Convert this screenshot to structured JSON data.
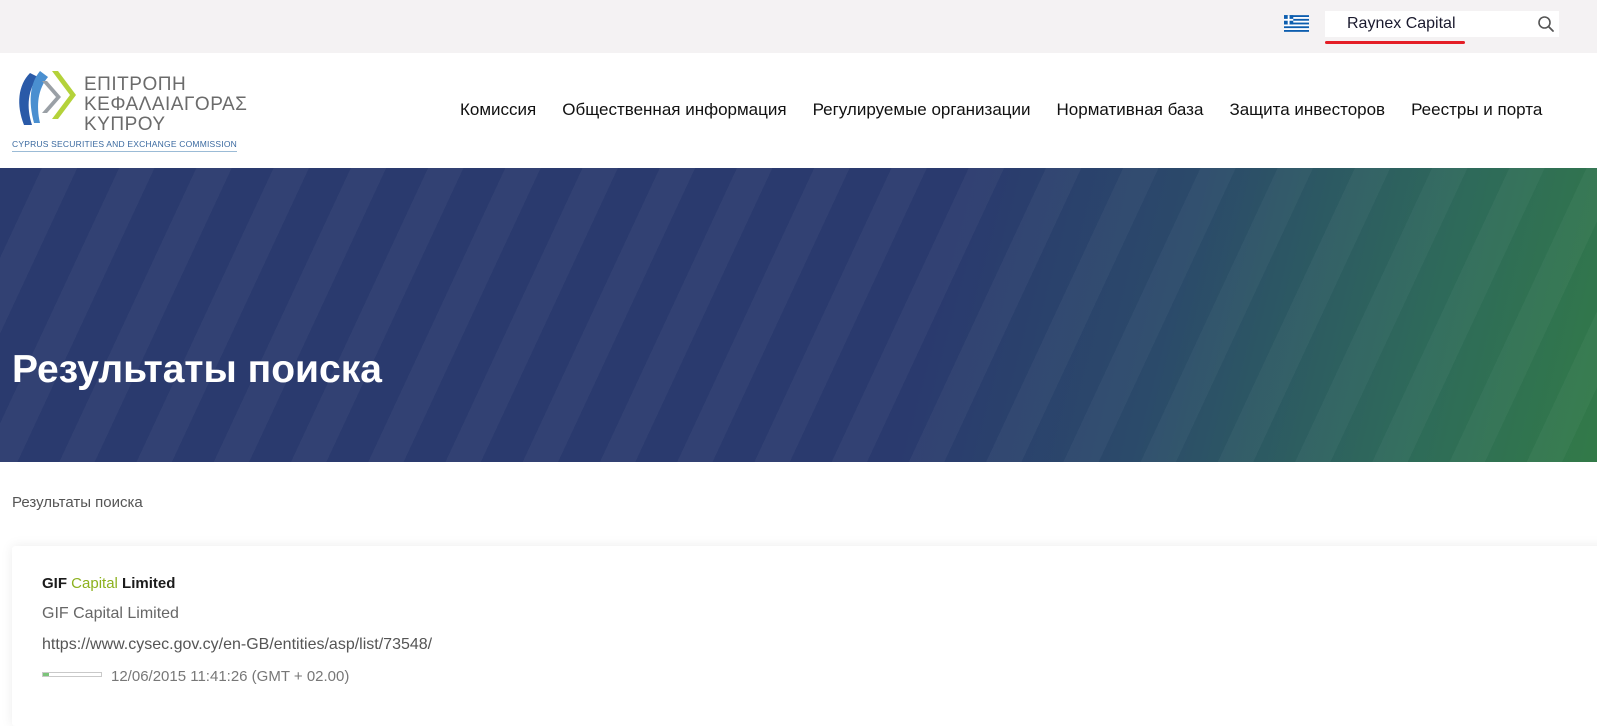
{
  "topbar": {
    "language_flag": "greek-flag-icon",
    "search": {
      "value": "Raynex Capital",
      "placeholder": ""
    },
    "search_icon": "search-icon"
  },
  "logo": {
    "line1": "ΕΠΙΤΡΟΠΗ",
    "line2": "ΚΕΦΑΛΑΙΑΓΟΡΑΣ",
    "line3": "ΚΥΠΡΟΥ",
    "subtitle": "CYPRUS SECURITIES AND EXCHANGE COMMISSION"
  },
  "nav": {
    "items": [
      {
        "label": "Комиссия"
      },
      {
        "label": "Общественная информация"
      },
      {
        "label": "Регулируемые организации"
      },
      {
        "label": "Нормативная база"
      },
      {
        "label": "Защита инвесторов"
      },
      {
        "label": "Реестры и порта"
      }
    ]
  },
  "hero": {
    "title": "Результаты поиска"
  },
  "breadcrumb": {
    "current": "Результаты поиска"
  },
  "results": [
    {
      "title_prefix": "GIF ",
      "title_highlight": "Capital",
      "title_suffix": " Limited",
      "description": "GIF Capital Limited",
      "url": "https://www.cysec.gov.cy/en-GB/entities/asp/list/73548/",
      "relevance": 0.1,
      "date": "12/06/2015 11:41:26 (GMT + 02.00)"
    }
  ],
  "colors": {
    "hero_blue": "#2a3a6e",
    "hero_green": "#327a48",
    "highlight_green": "#8cb11e",
    "search_underline": "#e41e26"
  }
}
